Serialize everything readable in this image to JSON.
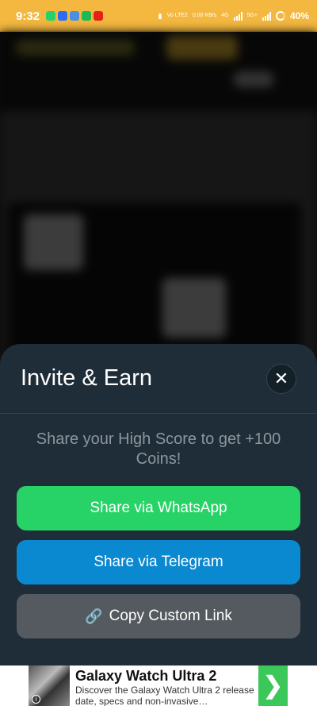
{
  "status_bar": {
    "time": "9:32",
    "network_labels": [
      "Vo LTE2",
      "0.00 KB/s",
      "4G",
      "5G+"
    ],
    "battery": "40%"
  },
  "modal": {
    "title": "Invite & Earn",
    "close_label": "✕",
    "promo_text": "Share your High Score to get +100 Coins!",
    "buttons": {
      "whatsapp": "Share via WhatsApp",
      "telegram": "Share via Telegram",
      "copy_link": "Copy Custom Link",
      "copy_link_icon": "🔗"
    }
  },
  "ad": {
    "title": "Galaxy Watch Ultra 2",
    "description": "Discover the Galaxy Watch Ultra 2 release date, specs and non-invasive…",
    "info_icon": "i",
    "arrow_icon": "❯"
  },
  "colors": {
    "status_bar": "#f4b840",
    "sheet": "#1f2d38",
    "whatsapp": "#27d366",
    "telegram": "#0a88d0",
    "copy": "#545a5f",
    "ad_arrow": "#3cc75a"
  }
}
